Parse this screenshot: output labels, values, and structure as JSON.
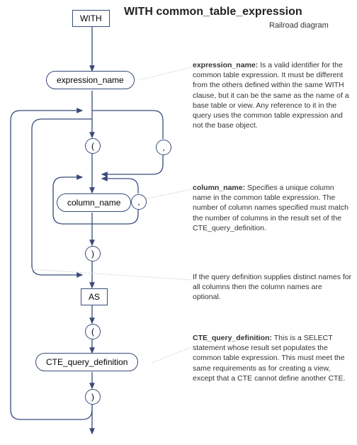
{
  "header": {
    "title": "WITH common_table_expression",
    "subtitle": "Railroad diagram"
  },
  "nodes": {
    "with": "WITH",
    "expression_name": "expression_name",
    "open_paren_1": "(",
    "comma_top": ",",
    "column_name": "column_name",
    "comma_loop": ",",
    "close_paren_1": ")",
    "as": "AS",
    "open_paren_2": "(",
    "cte_query_definition": "CTE_query_definition",
    "close_paren_2": ")"
  },
  "callouts": {
    "expression_name": {
      "label": "expression_name:",
      "text": "Is a valid identifier for the common table expression. It must be different from the others defined within the same WITH  clause, but it can be the same as the name of a base table or view. Any reference to it  in the query uses the common table expression and not the base object."
    },
    "column_name": {
      "label": "column_name:",
      "text": "Specifies a unique column name in the common table expression. The number of column names specified must match the number of columns in the result set of the CTE_query_definition."
    },
    "optional_cols": {
      "text": "If the query definition supplies distinct names for all  columns then the column names are optional."
    },
    "cte_query_definition": {
      "label": "CTE_query_definition:",
      "text": "This is a SELECT statement whose result set populates the common table expression. This must meet the same requirements as for creating a view, except that  a CTE cannot define another CTE."
    }
  }
}
